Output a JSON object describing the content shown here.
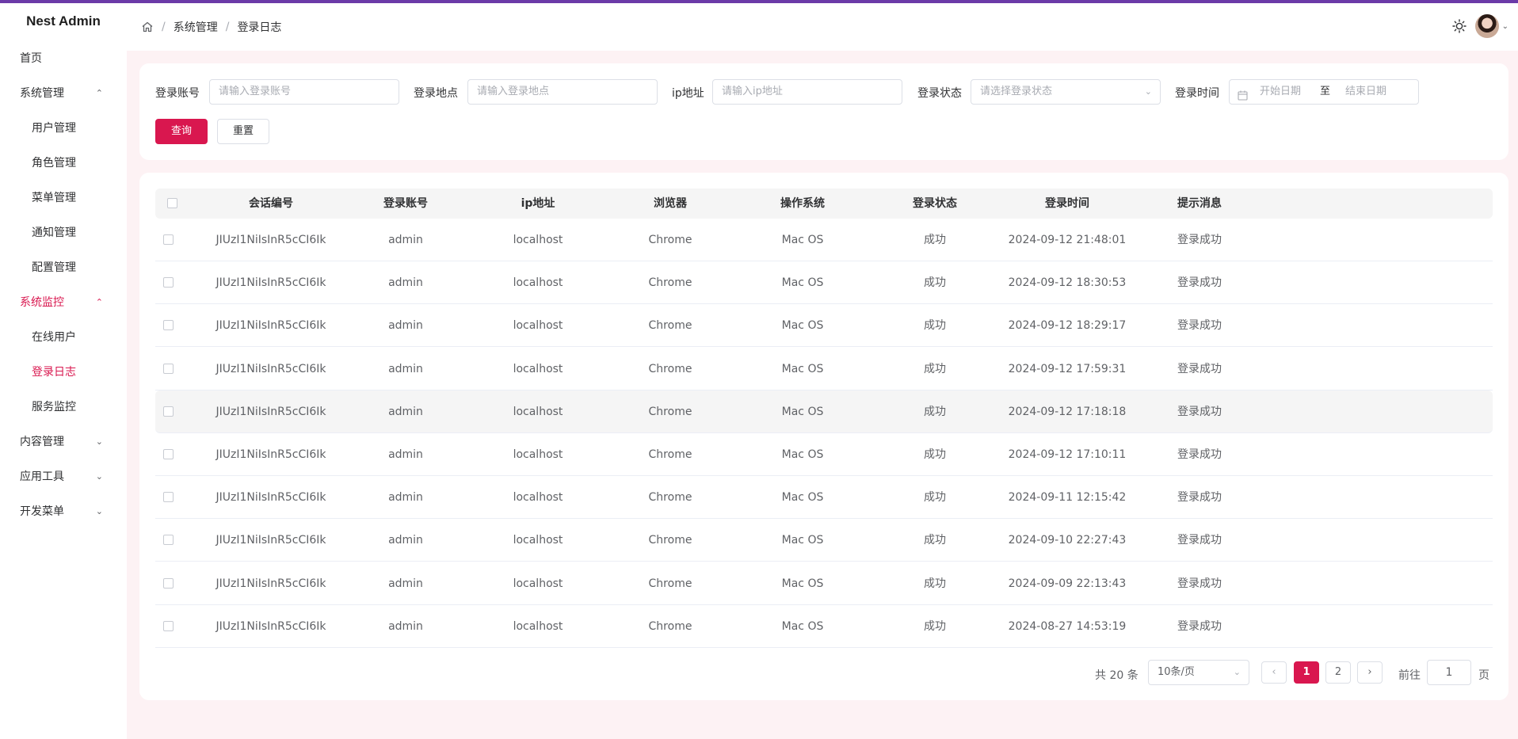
{
  "colors": {
    "accent": "#d9174f",
    "topline": "#6b3aa8",
    "page_bg": "#fdf2f4"
  },
  "sidebar": {
    "logo": "Nest Admin",
    "items": [
      {
        "label": "首页",
        "level": 1,
        "arrow": ""
      },
      {
        "label": "系统管理",
        "level": 1,
        "arrow": "up"
      },
      {
        "label": "用户管理",
        "level": 2
      },
      {
        "label": "角色管理",
        "level": 2
      },
      {
        "label": "菜单管理",
        "level": 2
      },
      {
        "label": "通知管理",
        "level": 2
      },
      {
        "label": "配置管理",
        "level": 2
      },
      {
        "label": "系统监控",
        "level": 1,
        "arrow": "up",
        "active": true
      },
      {
        "label": "在线用户",
        "level": 2
      },
      {
        "label": "登录日志",
        "level": 2,
        "active": true
      },
      {
        "label": "服务监控",
        "level": 2
      },
      {
        "label": "内容管理",
        "level": 1,
        "arrow": "down"
      },
      {
        "label": "应用工具",
        "level": 1,
        "arrow": "down"
      },
      {
        "label": "开发菜单",
        "level": 1,
        "arrow": "down"
      }
    ]
  },
  "header": {
    "breadcrumb": [
      "系统管理",
      "登录日志"
    ],
    "icons": [
      "home-icon",
      "sun-icon",
      "avatar",
      "chevron-down-icon"
    ]
  },
  "search": {
    "account_label": "登录账号",
    "account_placeholder": "请输入登录账号",
    "location_label": "登录地点",
    "location_placeholder": "请输入登录地点",
    "ip_label": "ip地址",
    "ip_placeholder": "请输入ip地址",
    "status_label": "登录状态",
    "status_placeholder": "请选择登录状态",
    "time_label": "登录时间",
    "start_placeholder": "开始日期",
    "range_sep": "至",
    "end_placeholder": "结束日期",
    "query_button": "查询",
    "reset_button": "重置"
  },
  "table": {
    "columns": [
      "会话编号",
      "登录账号",
      "ip地址",
      "浏览器",
      "操作系统",
      "登录状态",
      "登录时间",
      "提示消息"
    ],
    "rows": [
      [
        "JIUzI1NiIsInR5cCI6Ik",
        "admin",
        "localhost",
        "Chrome",
        "Mac OS",
        "成功",
        "2024-09-12 21:48:01",
        "登录成功"
      ],
      [
        "JIUzI1NiIsInR5cCI6Ik",
        "admin",
        "localhost",
        "Chrome",
        "Mac OS",
        "成功",
        "2024-09-12 18:30:53",
        "登录成功"
      ],
      [
        "JIUzI1NiIsInR5cCI6Ik",
        "admin",
        "localhost",
        "Chrome",
        "Mac OS",
        "成功",
        "2024-09-12 18:29:17",
        "登录成功"
      ],
      [
        "JIUzI1NiIsInR5cCI6Ik",
        "admin",
        "localhost",
        "Chrome",
        "Mac OS",
        "成功",
        "2024-09-12 17:59:31",
        "登录成功"
      ],
      [
        "JIUzI1NiIsInR5cCI6Ik",
        "admin",
        "localhost",
        "Chrome",
        "Mac OS",
        "成功",
        "2024-09-12 17:18:18",
        "登录成功"
      ],
      [
        "JIUzI1NiIsInR5cCI6Ik",
        "admin",
        "localhost",
        "Chrome",
        "Mac OS",
        "成功",
        "2024-09-12 17:10:11",
        "登录成功"
      ],
      [
        "JIUzI1NiIsInR5cCI6Ik",
        "admin",
        "localhost",
        "Chrome",
        "Mac OS",
        "成功",
        "2024-09-11 12:15:42",
        "登录成功"
      ],
      [
        "JIUzI1NiIsInR5cCI6Ik",
        "admin",
        "localhost",
        "Chrome",
        "Mac OS",
        "成功",
        "2024-09-10 22:27:43",
        "登录成功"
      ],
      [
        "JIUzI1NiIsInR5cCI6Ik",
        "admin",
        "localhost",
        "Chrome",
        "Mac OS",
        "成功",
        "2024-09-09 22:13:43",
        "登录成功"
      ],
      [
        "JIUzI1NiIsInR5cCI6Ik",
        "admin",
        "localhost",
        "Chrome",
        "Mac OS",
        "成功",
        "2024-08-27 14:53:19",
        "登录成功"
      ]
    ]
  },
  "pagination": {
    "total": "共 20 条",
    "page_size": "10条/页",
    "pages": [
      "1",
      "2"
    ],
    "current": "1",
    "goto_prefix": "前往",
    "goto_value": "1",
    "goto_suffix": "页"
  }
}
